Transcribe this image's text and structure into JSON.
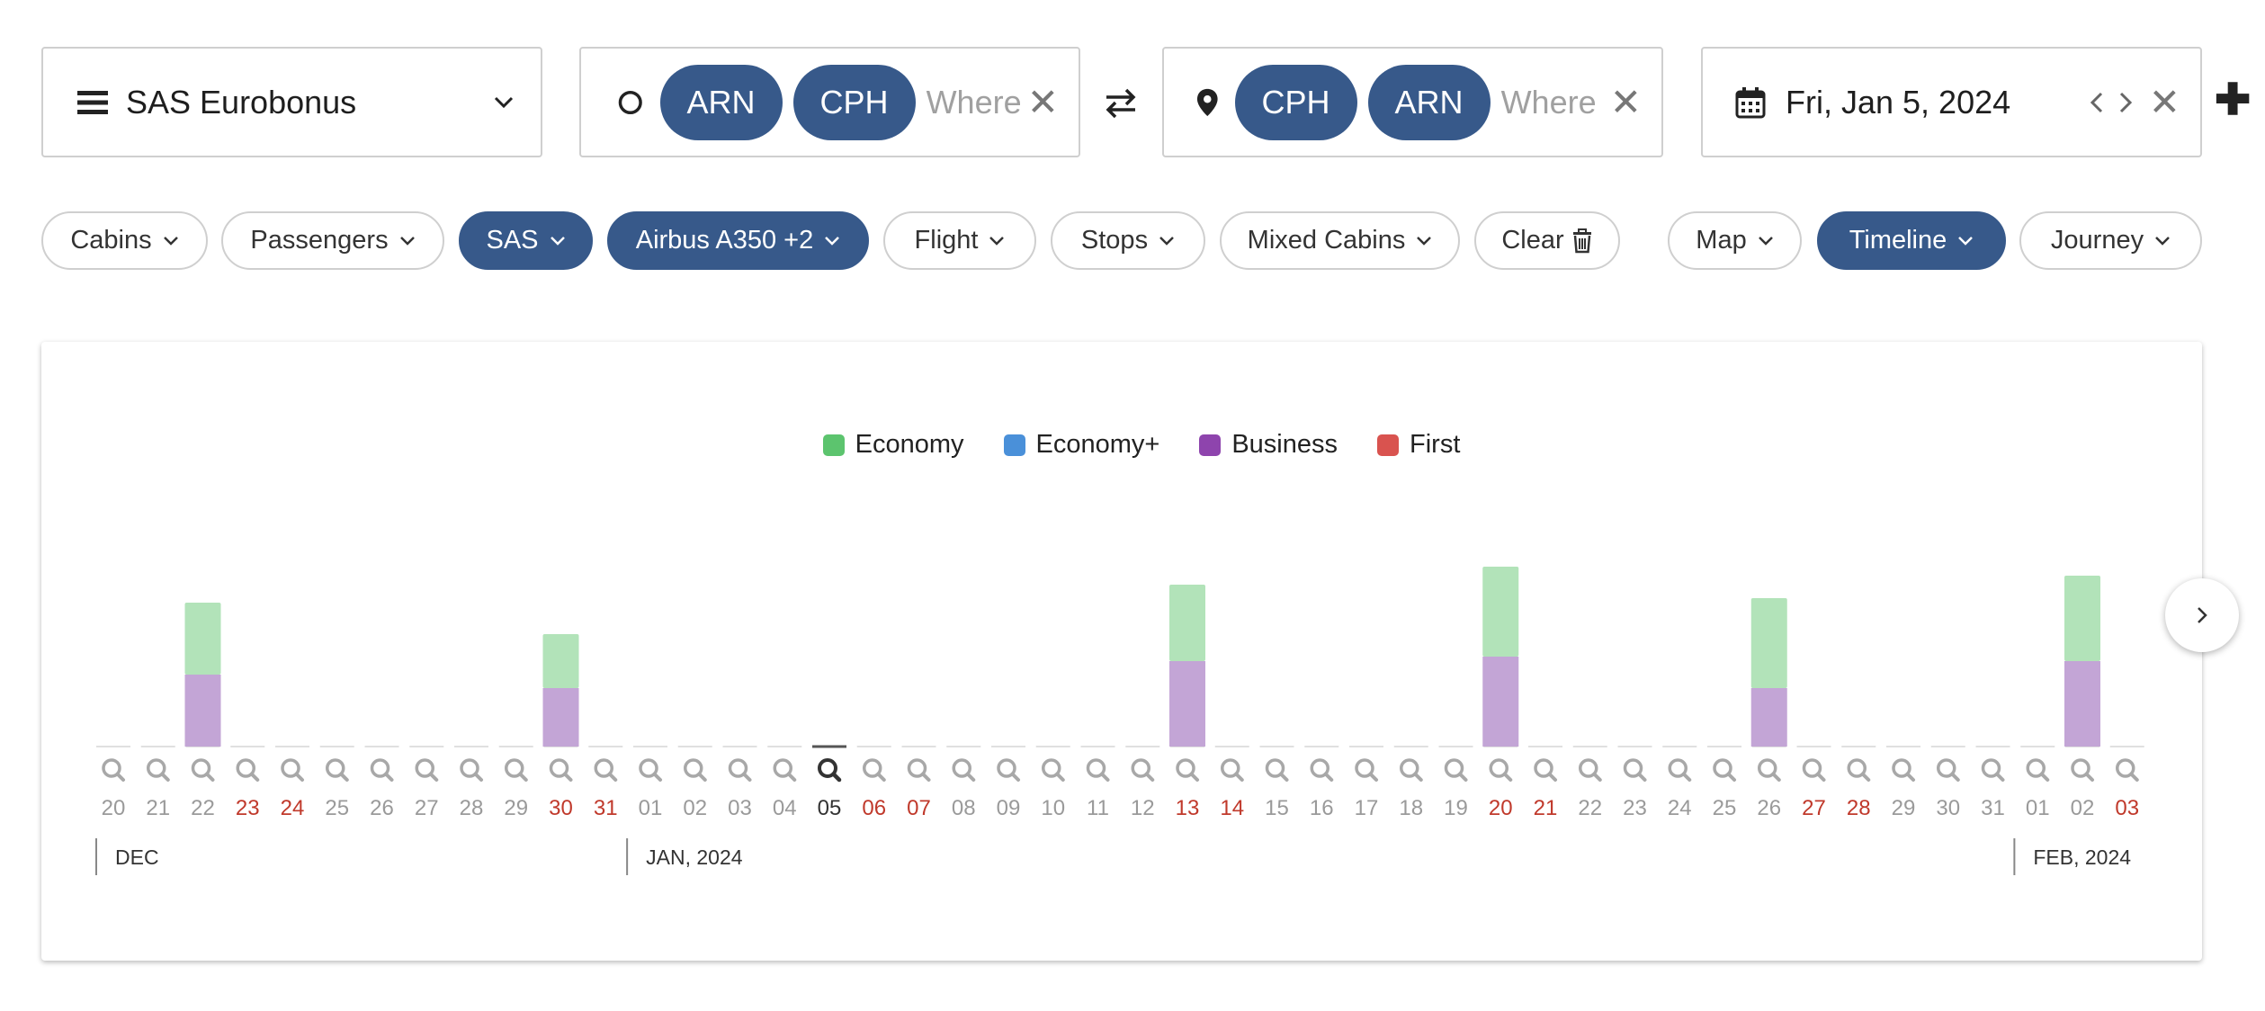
{
  "search": {
    "program": "SAS Eurobonus",
    "origins": [
      "ARN",
      "CPH"
    ],
    "origin_placeholder": "Where else?",
    "destinations": [
      "CPH",
      "ARN"
    ],
    "destination_placeholder": "Where else?",
    "date": "Fri, Jan 5, 2024"
  },
  "filters": [
    {
      "label": "Cabins",
      "active": false
    },
    {
      "label": "Passengers",
      "active": false
    },
    {
      "label": "SAS",
      "active": true
    },
    {
      "label": "Airbus A350 +2",
      "active": true
    },
    {
      "label": "Flight",
      "active": false
    },
    {
      "label": "Stops",
      "active": false
    },
    {
      "label": "Mixed Cabins",
      "active": false
    },
    {
      "label": "Clear",
      "active": false
    }
  ],
  "views": [
    {
      "label": "Map",
      "active": false
    },
    {
      "label": "Timeline",
      "active": true
    },
    {
      "label": "Journey",
      "active": false
    }
  ],
  "colors": {
    "accent": "#37598a",
    "weekend": "#c0392b",
    "economy_bar": "#b2e3b9",
    "business_bar": "#c3a5d6"
  },
  "chart_data": {
    "type": "bar",
    "legend": [
      {
        "name": "Economy",
        "color": "#5cc46e"
      },
      {
        "name": "Economy+",
        "color": "#4a90d9"
      },
      {
        "name": "Business",
        "color": "#8e44ad"
      },
      {
        "name": "First",
        "color": "#d9534f"
      }
    ],
    "days": [
      {
        "d": "20",
        "w": false
      },
      {
        "d": "21",
        "w": false
      },
      {
        "d": "22",
        "w": false
      },
      {
        "d": "23",
        "w": true
      },
      {
        "d": "24",
        "w": true
      },
      {
        "d": "25",
        "w": false
      },
      {
        "d": "26",
        "w": false
      },
      {
        "d": "27",
        "w": false
      },
      {
        "d": "28",
        "w": false
      },
      {
        "d": "29",
        "w": false
      },
      {
        "d": "30",
        "w": true
      },
      {
        "d": "31",
        "w": true
      },
      {
        "d": "01",
        "w": false
      },
      {
        "d": "02",
        "w": false
      },
      {
        "d": "03",
        "w": false
      },
      {
        "d": "04",
        "w": false
      },
      {
        "d": "05",
        "w": false,
        "selected": true
      },
      {
        "d": "06",
        "w": true
      },
      {
        "d": "07",
        "w": true
      },
      {
        "d": "08",
        "w": false
      },
      {
        "d": "09",
        "w": false
      },
      {
        "d": "10",
        "w": false
      },
      {
        "d": "11",
        "w": false
      },
      {
        "d": "12",
        "w": false
      },
      {
        "d": "13",
        "w": true
      },
      {
        "d": "14",
        "w": true
      },
      {
        "d": "15",
        "w": false
      },
      {
        "d": "16",
        "w": false
      },
      {
        "d": "17",
        "w": false
      },
      {
        "d": "18",
        "w": false
      },
      {
        "d": "19",
        "w": false
      },
      {
        "d": "20",
        "w": true
      },
      {
        "d": "21",
        "w": true
      },
      {
        "d": "22",
        "w": false
      },
      {
        "d": "23",
        "w": false
      },
      {
        "d": "24",
        "w": false
      },
      {
        "d": "25",
        "w": false
      },
      {
        "d": "26",
        "w": false
      },
      {
        "d": "27",
        "w": true
      },
      {
        "d": "28",
        "w": true
      },
      {
        "d": "29",
        "w": false
      },
      {
        "d": "30",
        "w": false
      },
      {
        "d": "31",
        "w": false
      },
      {
        "d": "01",
        "w": false
      },
      {
        "d": "02",
        "w": false
      },
      {
        "d": "03",
        "w": true
      }
    ],
    "series": [
      {
        "name": "Economy",
        "values": [
          0,
          0,
          1.6,
          0,
          0,
          0,
          0,
          0,
          0,
          0,
          1.2,
          0,
          0,
          0,
          0,
          0,
          0,
          0,
          0,
          0,
          0,
          0,
          0,
          0,
          1.7,
          0,
          0,
          0,
          0,
          0,
          0,
          2.0,
          0,
          0,
          0,
          0,
          0,
          2.0,
          0,
          0,
          0,
          0,
          0,
          0,
          1.9,
          0
        ]
      },
      {
        "name": "Business",
        "values": [
          0,
          0,
          1.6,
          0,
          0,
          0,
          0,
          0,
          0,
          0,
          1.3,
          0,
          0,
          0,
          0,
          0,
          0,
          0,
          0,
          0,
          0,
          0,
          0,
          0,
          1.9,
          0,
          0,
          0,
          0,
          0,
          0,
          2.0,
          0,
          0,
          0,
          0,
          0,
          1.3,
          0,
          0,
          0,
          0,
          0,
          0,
          1.9,
          0
        ]
      }
    ],
    "months": [
      {
        "label": "DEC",
        "start_index": 0
      },
      {
        "label": "JAN, 2024",
        "start_index": 12
      },
      {
        "label": "FEB, 2024",
        "start_index": 43
      }
    ]
  }
}
